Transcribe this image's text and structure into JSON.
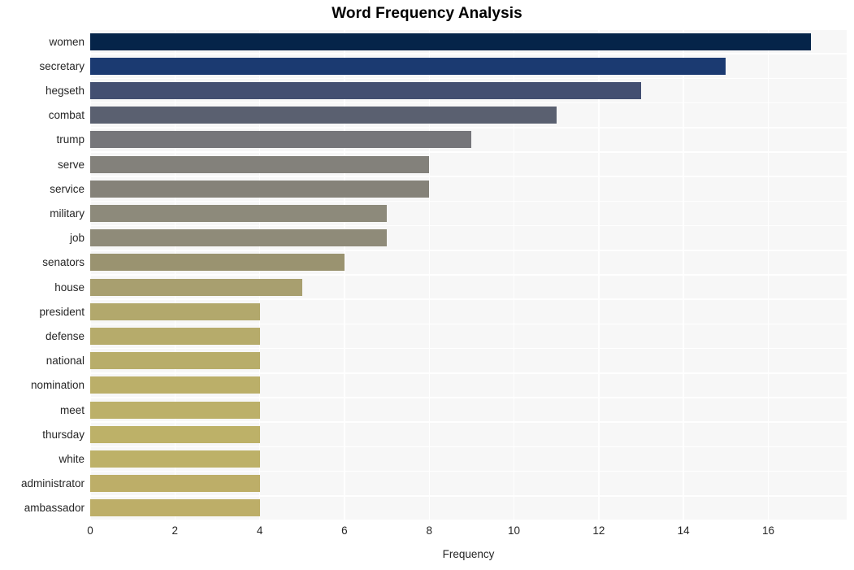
{
  "chart_data": {
    "type": "bar",
    "orientation": "horizontal",
    "title": "Word Frequency Analysis",
    "xlabel": "Frequency",
    "ylabel": "",
    "categories": [
      "women",
      "secretary",
      "hegseth",
      "combat",
      "trump",
      "serve",
      "service",
      "military",
      "job",
      "senators",
      "house",
      "president",
      "defense",
      "national",
      "nomination",
      "meet",
      "thursday",
      "white",
      "administrator",
      "ambassador"
    ],
    "values": [
      17,
      15,
      13,
      11,
      9,
      8,
      8,
      7,
      7,
      6,
      5,
      4,
      4,
      4,
      4,
      4,
      4,
      4,
      4,
      4
    ],
    "bar_colors": [
      "#052449",
      "#1b3a71",
      "#434f71",
      "#5a6070",
      "#76767a",
      "#83817b",
      "#858279",
      "#8d8a7b",
      "#8f8b79",
      "#9a9370",
      "#a89f6f",
      "#b2a86c",
      "#b6ab6b",
      "#b8ad6a",
      "#bbaf69",
      "#bcb069",
      "#bdb168",
      "#bdb168",
      "#bdae68",
      "#bdae68"
    ],
    "xticks": [
      0,
      2,
      4,
      6,
      8,
      10,
      12,
      14,
      16
    ],
    "xticklabels": [
      "0",
      "2",
      "4",
      "6",
      "8",
      "10",
      "12",
      "14",
      "16"
    ],
    "xlim": [
      0,
      17.85
    ],
    "grid": true,
    "grid_color": "#ffffff",
    "plot_background": "#f7f7f7",
    "figure_background": "#ffffff",
    "legend": null,
    "title_color": "#000000",
    "tick_color": "#262626"
  }
}
